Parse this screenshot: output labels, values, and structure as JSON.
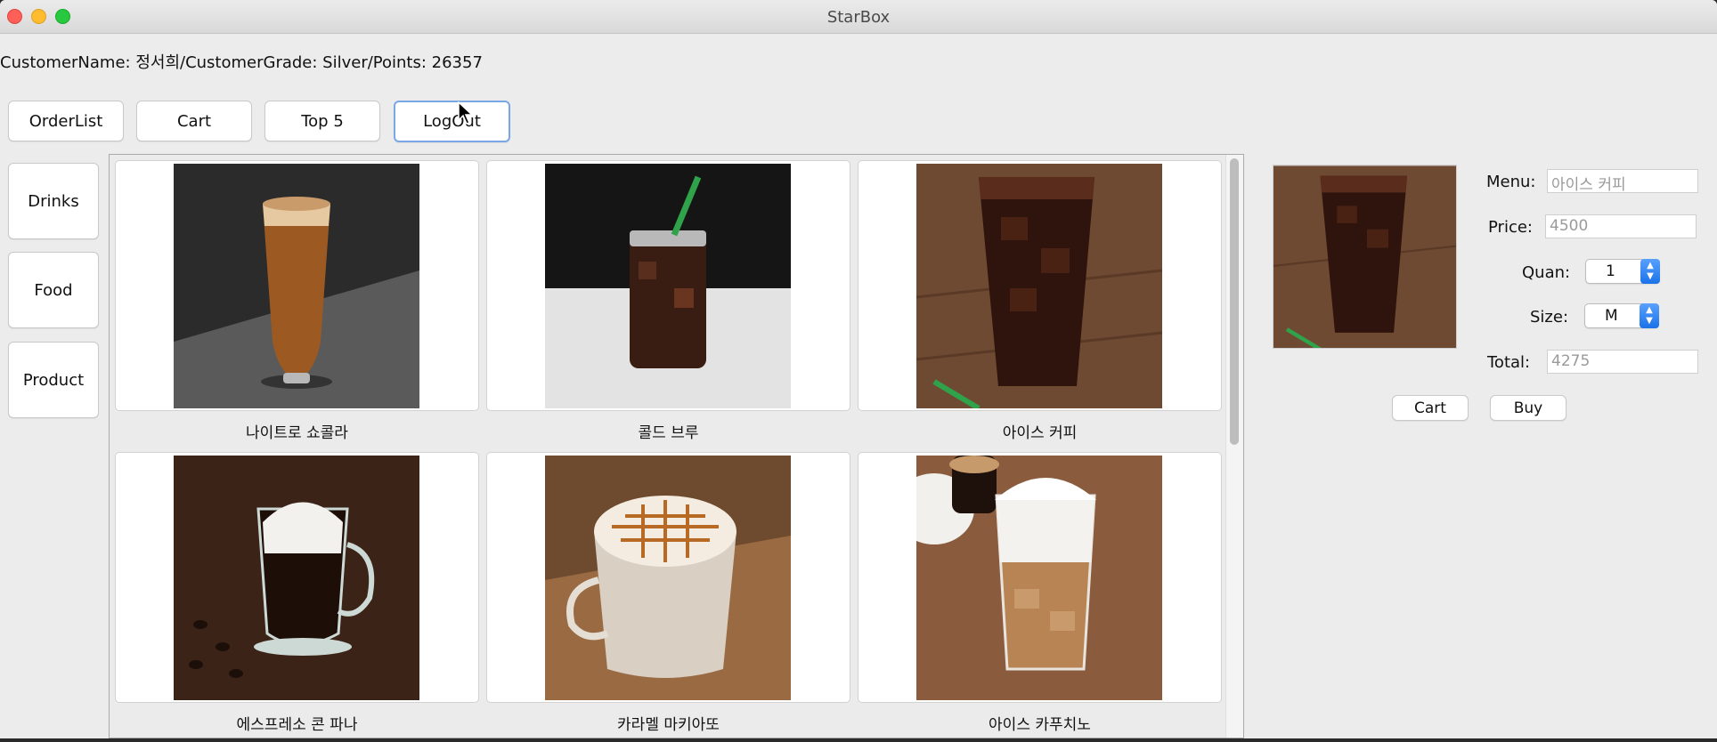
{
  "window": {
    "title": "StarBox"
  },
  "customer": {
    "info": "CustomerName: 정서희/CustomerGrade: Silver/Points: 26357"
  },
  "toolbar": [
    {
      "label": "OrderList"
    },
    {
      "label": "Cart"
    },
    {
      "label": "Top 5"
    },
    {
      "label": "LogOut"
    }
  ],
  "categories": [
    {
      "label": "Drinks"
    },
    {
      "label": "Food"
    },
    {
      "label": "Product"
    }
  ],
  "menu_items": [
    {
      "name": "나이트로 쇼콜라",
      "icon": "nitro-chocolate-glass-photo"
    },
    {
      "name": "콜드 브루",
      "icon": "cold-brew-jar-photo"
    },
    {
      "name": "아이스 커피",
      "icon": "iced-coffee-glass-photo"
    },
    {
      "name": "에스프레소 콘 파나",
      "icon": "espresso-con-panna-photo"
    },
    {
      "name": "카라멜 마키아또",
      "icon": "caramel-macchiato-photo"
    },
    {
      "name": "아이스 카푸치노",
      "icon": "iced-cappuccino-photo"
    }
  ],
  "detail": {
    "menu_label": "Menu:",
    "menu_value": "아이스 커피",
    "price_label": "Price:",
    "price_value": "4500",
    "quan_label": "Quan:",
    "quan_value": "1",
    "size_label": "Size:",
    "size_value": "M",
    "total_label": "Total:",
    "total_value": "4275",
    "cart_label": "Cart",
    "buy_label": "Buy"
  }
}
